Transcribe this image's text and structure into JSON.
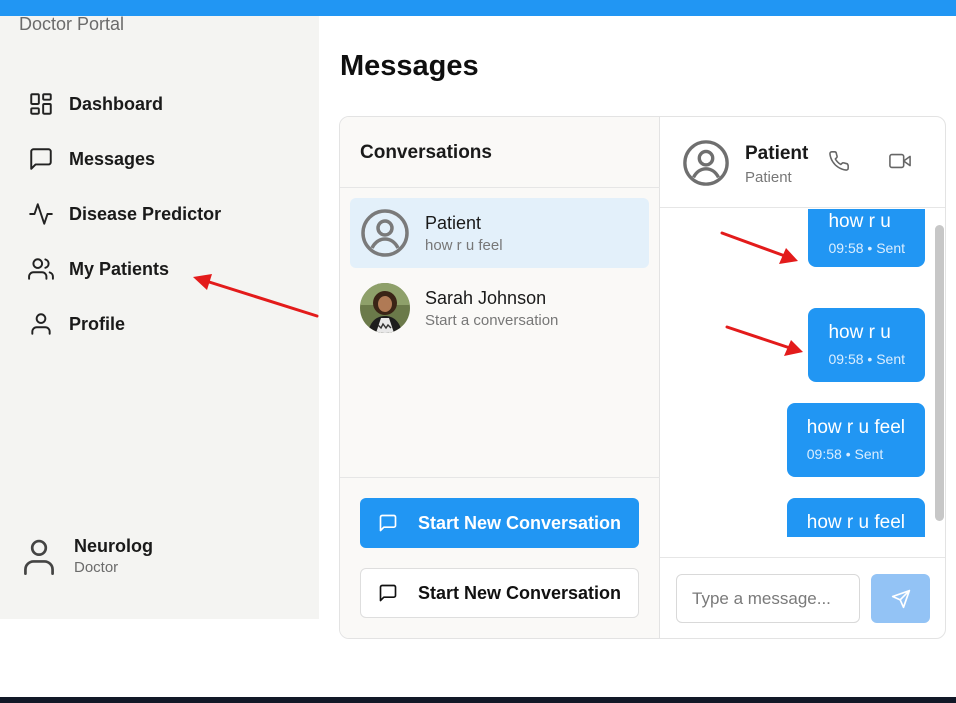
{
  "app": {
    "brand": "Doctor Portal"
  },
  "sidebar": {
    "items": [
      {
        "label": "Dashboard",
        "icon": "dashboard-icon"
      },
      {
        "label": "Messages",
        "icon": "message-square-icon"
      },
      {
        "label": "Disease Predictor",
        "icon": "activity-icon"
      },
      {
        "label": "My Patients",
        "icon": "users-icon"
      },
      {
        "label": "Profile",
        "icon": "user-icon"
      }
    ],
    "user": {
      "name": "Neurolog",
      "role": "Doctor"
    }
  },
  "page": {
    "title": "Messages"
  },
  "conversations": {
    "heading": "Conversations",
    "items": [
      {
        "name": "Patient",
        "last_message": "how r u feel",
        "active": true
      },
      {
        "name": "Sarah Johnson",
        "last_message": "Start a conversation",
        "active": false
      }
    ],
    "buttons": {
      "primary": "Start New Conversation",
      "secondary": "Start New Conversation"
    }
  },
  "chat": {
    "contact_name": "Patient",
    "contact_role": "Patient",
    "messages": [
      {
        "text": "how r u",
        "time": "09:58",
        "status": "Sent",
        "meta": "09:58 • Sent"
      },
      {
        "text": "how r u",
        "time": "09:58",
        "status": "Sent",
        "meta": "09:58 • Sent"
      },
      {
        "text": "how r u feel",
        "time": "09:58",
        "status": "Sent",
        "meta": "09:58 • Sent"
      },
      {
        "text": "how r u feel",
        "time": "",
        "status": "",
        "meta": ""
      }
    ],
    "input_placeholder": "Type a message..."
  },
  "colors": {
    "accent": "#2196f3",
    "sidebar_bg": "#f4f4f2",
    "active_conversation_bg": "#e3f0fa",
    "send_button_disabled": "#93c3f5",
    "annotation_arrow": "#e31b1b"
  }
}
